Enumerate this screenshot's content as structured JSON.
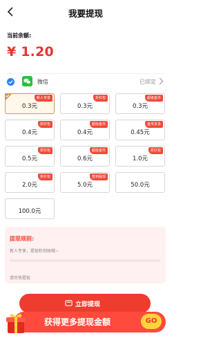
{
  "header": {
    "title": "我要提现",
    "back_icon": "chevron-left-icon"
  },
  "balance": {
    "label": "当前余额:",
    "value": "¥ 1.20",
    "color": "#e8352f"
  },
  "payment_method": {
    "name": "微信",
    "status": "已绑定",
    "selected": true,
    "icon": "wechat-icon"
  },
  "amounts": [
    {
      "value": "0.3元",
      "tag": "新人专享",
      "selected": true
    },
    {
      "value": "0.3元",
      "tag": "折红包",
      "selected": false
    },
    {
      "value": "0.3元",
      "tag": "超级金币",
      "selected": false
    },
    {
      "value": "0.4元",
      "tag": "折红包",
      "selected": false
    },
    {
      "value": "0.4元",
      "tag": "超级金币",
      "selected": false
    },
    {
      "value": "0.45元",
      "tag": "金币多多",
      "selected": false
    },
    {
      "value": "0.5元",
      "tag": "折红包",
      "selected": false
    },
    {
      "value": "0.6元",
      "tag": "超级金币",
      "selected": false
    },
    {
      "value": "1.0元",
      "tag": "折红包",
      "selected": false
    },
    {
      "value": "2.0元",
      "tag": "折红包",
      "selected": false
    },
    {
      "value": "5.0元",
      "tag": "签到提现",
      "selected": false
    },
    {
      "value": "50.0元",
      "tag": "",
      "selected": false
    },
    {
      "value": "100.0元",
      "tag": "",
      "selected": false
    }
  ],
  "rules": {
    "title": "提现规则:",
    "text": "新人专享，提现秒到账哦~",
    "hint": "请尽快提现"
  },
  "withdraw_button": {
    "label": "立即提现",
    "icon": "wallet-icon"
  },
  "banner": {
    "text": "获得更多提现金额",
    "go_label": "GO",
    "icon": "gift-box-icon"
  },
  "colors": {
    "accent": "#ee3c2e",
    "wechat": "#2bbf3c",
    "check": "#2f7ff0",
    "selected_border": "#c99a5a"
  }
}
